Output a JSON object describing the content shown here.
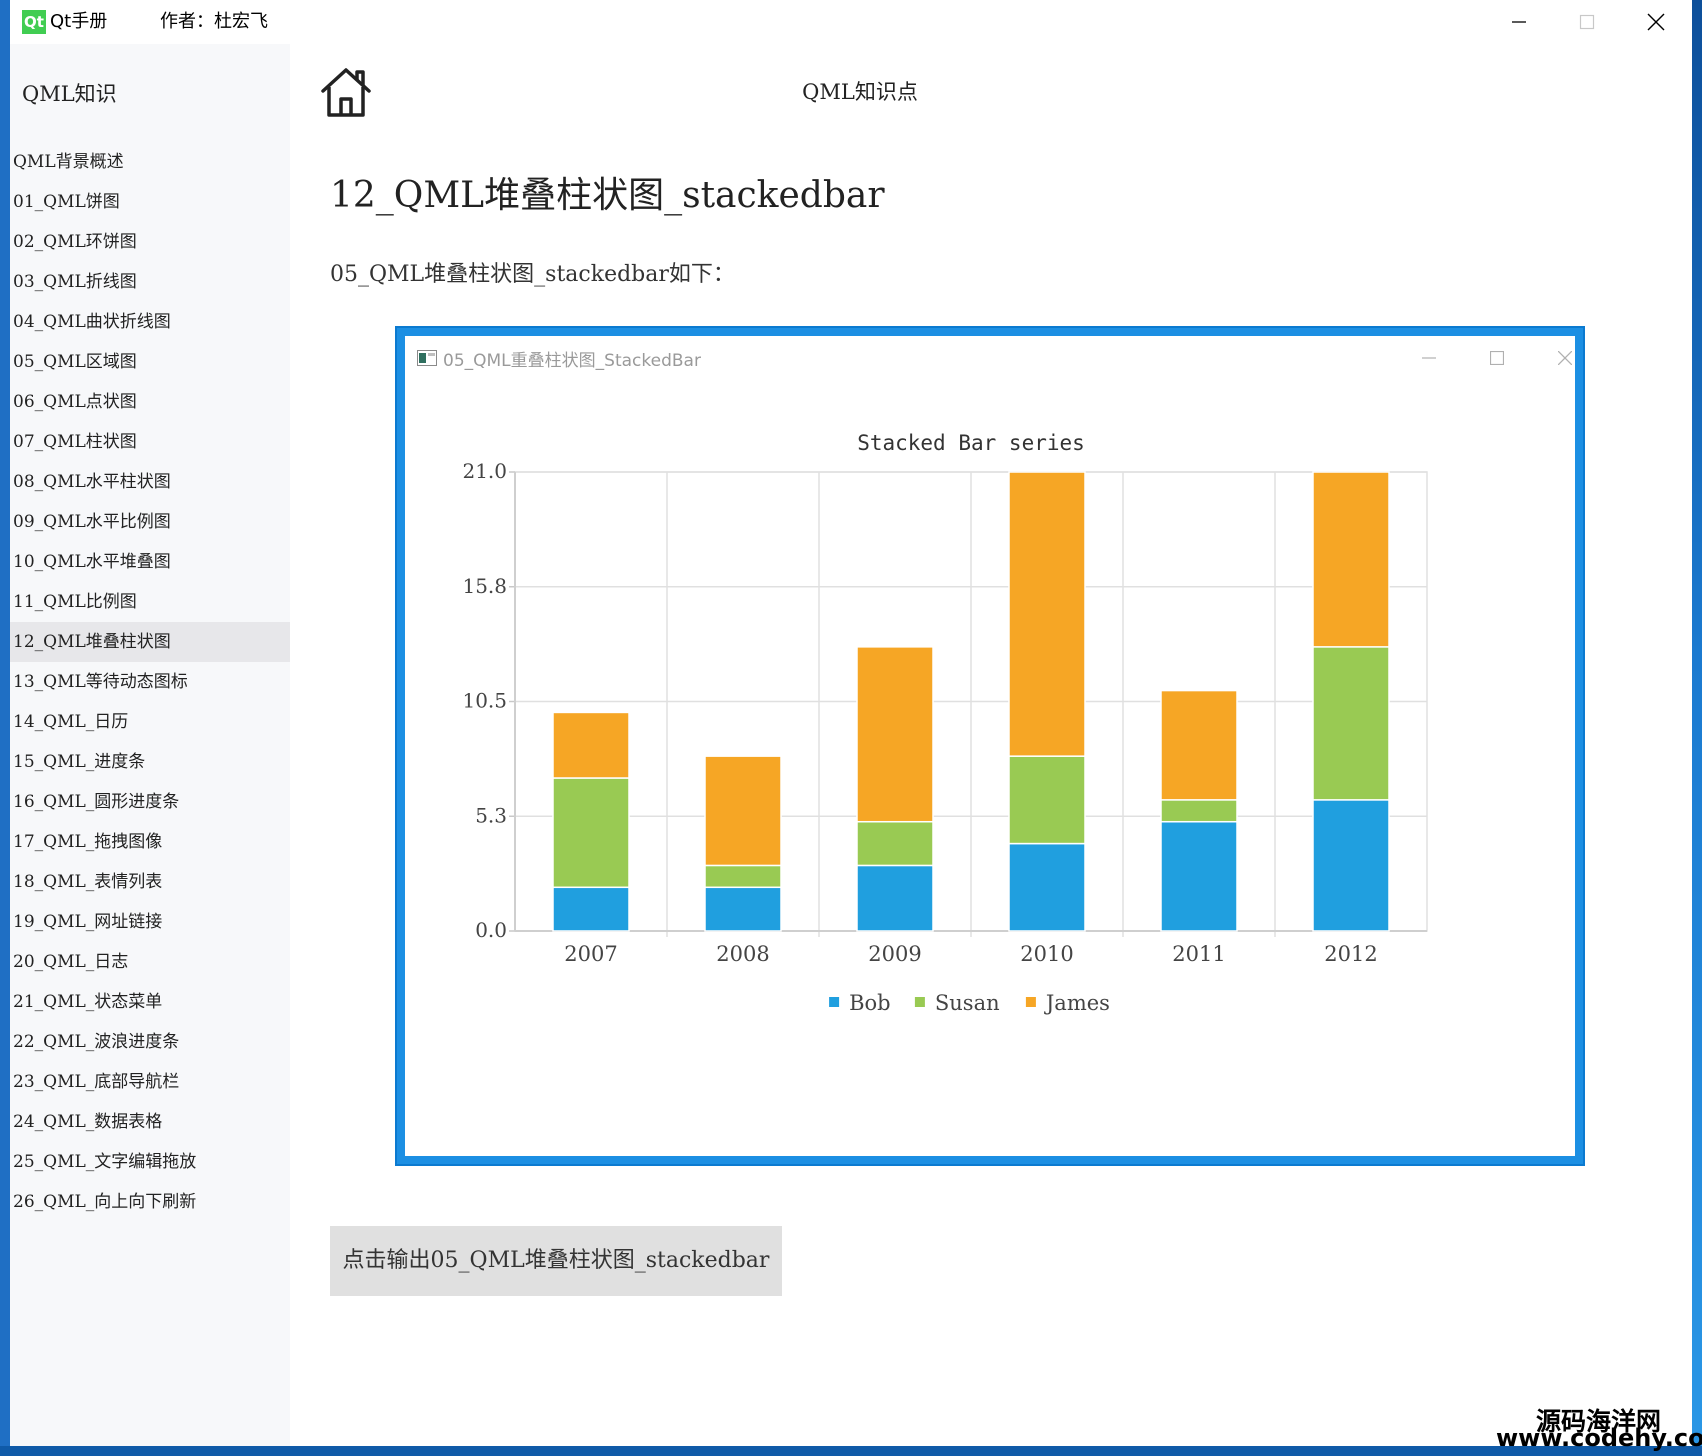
{
  "app": {
    "logo": "Qt",
    "title": "Qt手册",
    "author": "作者：杜宏飞"
  },
  "sidebar": {
    "header": "QML知识",
    "items": [
      "QML背景概述",
      "01_QML饼图",
      "02_QML环饼图",
      "03_QML折线图",
      "04_QML曲状折线图",
      "05_QML区域图",
      "06_QML点状图",
      "07_QML柱状图",
      "08_QML水平柱状图",
      "09_QML水平比例图",
      "10_QML水平堆叠图",
      "11_QML比例图",
      "12_QML堆叠柱状图",
      "13_QML等待动态图标",
      "14_QML_日历",
      "15_QML_进度条",
      "16_QML_圆形进度条",
      "17_QML_拖拽图像",
      "18_QML_表情列表",
      "19_QML_网址链接",
      "20_QML_日志",
      "21_QML_状态菜单",
      "22_QML_波浪进度条",
      "23_QML_底部导航栏",
      "24_QML_数据表格",
      "25_QML_文字编辑拖放",
      "26_QML_向上向下刷新"
    ],
    "active_index": 12
  },
  "header": {
    "title": "QML知识点"
  },
  "content": {
    "title": "12_QML堆叠柱状图_stackedbar",
    "desc": "05_QML堆叠柱状图_stackedbar如下：",
    "embed_window_title": "05_QML重叠柱状图_StackedBar",
    "button_label": "点击输出05_QML堆叠柱状图_stackedbar"
  },
  "chart_data": {
    "type": "bar",
    "stacked": true,
    "title": "Stacked Bar series",
    "categories": [
      "2007",
      "2008",
      "2009",
      "2010",
      "2011",
      "2012"
    ],
    "series": [
      {
        "name": "Bob",
        "color": "#209fdf",
        "values": [
          2,
          2,
          3,
          4,
          5,
          6
        ]
      },
      {
        "name": "Susan",
        "color": "#99ca53",
        "values": [
          5,
          1,
          2,
          4,
          1,
          7
        ]
      },
      {
        "name": "James",
        "color": "#f6a625",
        "values": [
          3,
          5,
          8,
          13,
          5,
          8
        ]
      }
    ],
    "ylim": [
      0,
      21
    ],
    "yticks": [
      "0.0",
      "5.3",
      "10.5",
      "15.8",
      "21.0"
    ],
    "grid": true,
    "legend": "bottom"
  },
  "watermark": {
    "cn": "源码海洋网",
    "url": "www.codehy.com"
  }
}
